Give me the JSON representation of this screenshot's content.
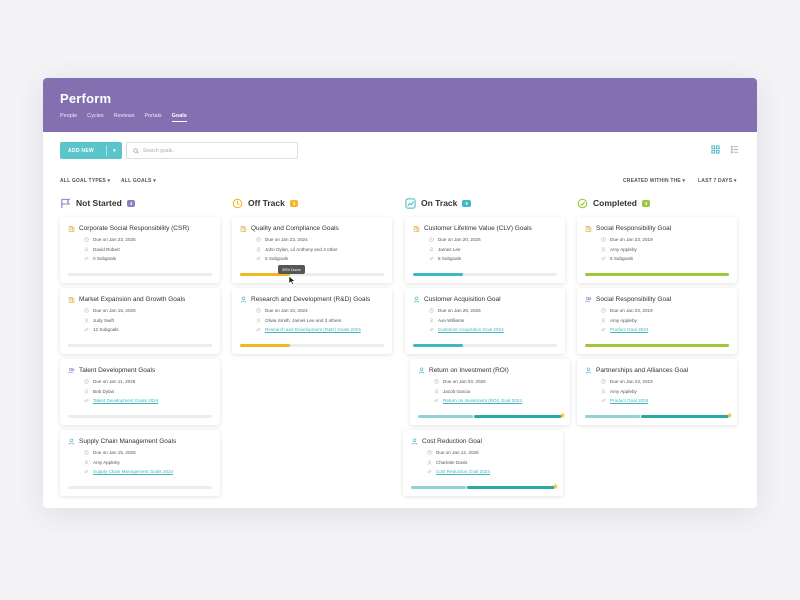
{
  "app": {
    "title": "Perform",
    "nav": [
      "People",
      "Cycles",
      "Reviews",
      "Portals",
      "Goals"
    ],
    "active_nav": "Goals",
    "header_color": "#8470b0"
  },
  "toolbar": {
    "add_label": "ADD NEW",
    "search_placeholder": "Search goals.."
  },
  "filters": {
    "types": "ALL GOAL TYPES",
    "goals": "ALL GOALS",
    "created": "CREATED WITHIN THE",
    "period": "LAST 7 DAYS"
  },
  "colors": {
    "accent": "#5cc5cc",
    "off_track": "#f2b822",
    "on_track": "#3fb8c4",
    "completed": "#9cc93a",
    "not_started": "#8a80c2",
    "teal_dark": "#2aa9a0"
  },
  "columns": [
    {
      "title": "Not Started",
      "count": "4",
      "icon": "flag-icon",
      "cards": [
        {
          "title": "Corporate Social Responsibility (CSR)",
          "icon": "building-icon",
          "due": "Due on Jan 23, 2025",
          "owner": "David Robert",
          "sub": "0 Subgoals",
          "sub_is_link": false,
          "progress": 0
        },
        {
          "title": "Market Expansion and Growth Goals",
          "icon": "building-icon",
          "due": "Due on Jan 15, 2025",
          "owner": "Judy Swift",
          "sub": "12 Subgoals",
          "sub_is_link": false,
          "progress": 0
        },
        {
          "title": "Talent Development Goals",
          "icon": "users-icon",
          "due": "Due on Jan 11, 2026",
          "owner": "Bob Dylan",
          "sub": "Talent Development Goals 2024",
          "sub_is_link": true,
          "progress": 0
        },
        {
          "title": "Supply Chain Management Goals",
          "icon": "user-icon",
          "due": "Due on Jan 15, 2025",
          "owner": "Amy Appleby",
          "sub": "Supply Chain Management Goals 2024",
          "sub_is_link": true,
          "progress": 0
        }
      ]
    },
    {
      "title": "Off Track",
      "count": "2",
      "icon": "clock-alert-icon",
      "cards": [
        {
          "title": "Quality and Compliance Goals",
          "icon": "building-icon",
          "due": "Due on Jan 23, 2024",
          "owner": "John Dylan, Lil Anthony and 2 other",
          "sub": "5 Subgoals",
          "sub_is_link": false,
          "progress": 0.35,
          "tooltip": "35% Done"
        },
        {
          "title": "Research and Development (R&D) Goals",
          "icon": "user-icon",
          "due": "Due on Jan 10, 2024",
          "owner": "Olivia Smith, James Lee and 3 others",
          "sub": "Research and Development (R&D) Goals 2024",
          "sub_is_link": true,
          "progress": 0.35
        }
      ]
    },
    {
      "title": "On Track",
      "count": "5",
      "icon": "chart-icon",
      "cards": [
        {
          "title": "Customer Lifetime Value (CLV) Goals",
          "icon": "building-icon",
          "due": "Due on Jan 20, 2025",
          "owner": "James Lee",
          "sub": "5 Subgoals",
          "sub_is_link": false,
          "progress": 0.35
        },
        {
          "title": "Customer Acquisition Goal",
          "icon": "user-icon",
          "due": "Due on Jan 26, 2025",
          "owner": "Ava Williams",
          "sub": "Customer Acquisition Goal 2024",
          "sub_is_link": true,
          "progress": 0.35
        },
        {
          "title": "Return on Investment (ROI)",
          "icon": "user-icon",
          "due": "Due on Jan 03, 2025",
          "owner": "Jacob Garcia",
          "sub": "Return on Investment (ROI) Goal 2024",
          "sub_is_link": true,
          "progress": 0.38,
          "progress2": 1.0,
          "starred": true
        },
        {
          "title": "Cost Reduction Goal",
          "icon": "user-icon",
          "due": "Due on Jan 12, 2026",
          "owner": "Charlotte Davis",
          "sub": "Cost Reduction Goal 2024",
          "sub_is_link": true,
          "progress": 0.38,
          "progress2": 1.0,
          "starred": true
        }
      ]
    },
    {
      "title": "Completed",
      "count": "3",
      "icon": "check-circle-icon",
      "cards": [
        {
          "title": "Social Responsibility Goal",
          "icon": "building-icon",
          "due": "Due on Jan 23, 2019",
          "owner": "Amy Appleby",
          "sub": "8 Subgoals",
          "sub_is_link": false,
          "progress": 1.0
        },
        {
          "title": "Social Responsibility Goal",
          "icon": "users-icon",
          "due": "Due on Jan 23, 2019",
          "owner": "Amy Appleby",
          "sub": "Product Goal 2024",
          "sub_is_link": true,
          "progress": 1.0
        },
        {
          "title": "Partnerships and Alliances Goal",
          "icon": "user-icon",
          "due": "Due on Jan 23, 2019",
          "owner": "Amy Appleby",
          "sub": "Product Goal 2024",
          "sub_is_link": true,
          "progress": 0.38,
          "progress2": 1.0,
          "starred": true
        }
      ]
    }
  ]
}
